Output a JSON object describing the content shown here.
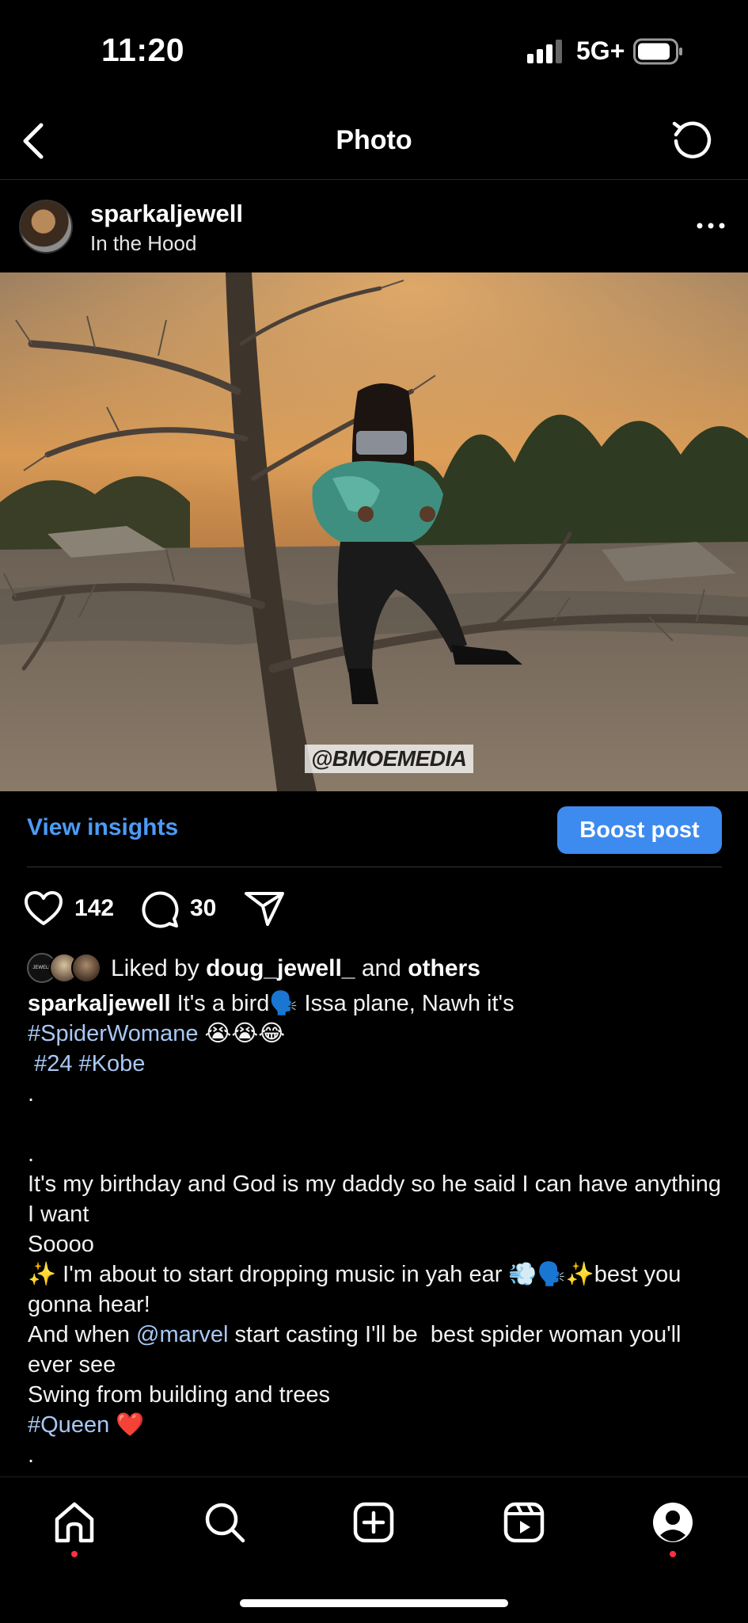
{
  "status_bar": {
    "time": "11:20",
    "network": "5G+"
  },
  "nav": {
    "title": "Photo"
  },
  "post": {
    "username": "sparkaljewell",
    "location": "In the Hood",
    "watermark": "@BMOEMEDIA"
  },
  "insights": {
    "view_label": "View insights",
    "boost_label": "Boost post"
  },
  "actions": {
    "likes": "142",
    "comments": "30"
  },
  "liked_by": {
    "prefix": "Liked by",
    "user": "doug_jewell_",
    "and": "and",
    "others": "others",
    "avatar1_text": "JEWELL"
  },
  "caption": {
    "username": "sparkaljewell",
    "line1_text": " It's a bird🗣️ Issa plane, Nawh it's",
    "line2_tag": "#SpiderWomane",
    "line2_emoji": " 😭😭😂",
    "line3_tag1": "#24",
    "line3_tag2": "#Kobe",
    "dot1": ".",
    "dot2": ".",
    "line4": "It's my birthday and God is my daddy so he said I can have anything I want",
    "line5": "Soooo",
    "line6": "✨ I'm about to start dropping music in yah ear 💨🗣️✨best you gonna hear!",
    "line7_pre": "And when ",
    "line7_mention": "@marvel",
    "line7_post": " start casting I'll be  best spider woman you'll ever see",
    "line8": "Swing from building and trees",
    "line9_tag": "#Queen",
    "line9_emoji": " ❤️",
    "dot3": "."
  },
  "colors": {
    "accent_blue": "#3e8bf0",
    "link_blue": "#4c9bf5",
    "notification_red": "#ff3040"
  },
  "icons": [
    "back-chevron-icon",
    "refresh-icon",
    "more-icon",
    "heart-icon",
    "comment-icon",
    "share-icon",
    "home-icon",
    "search-icon",
    "create-icon",
    "reels-icon",
    "profile-icon"
  ]
}
